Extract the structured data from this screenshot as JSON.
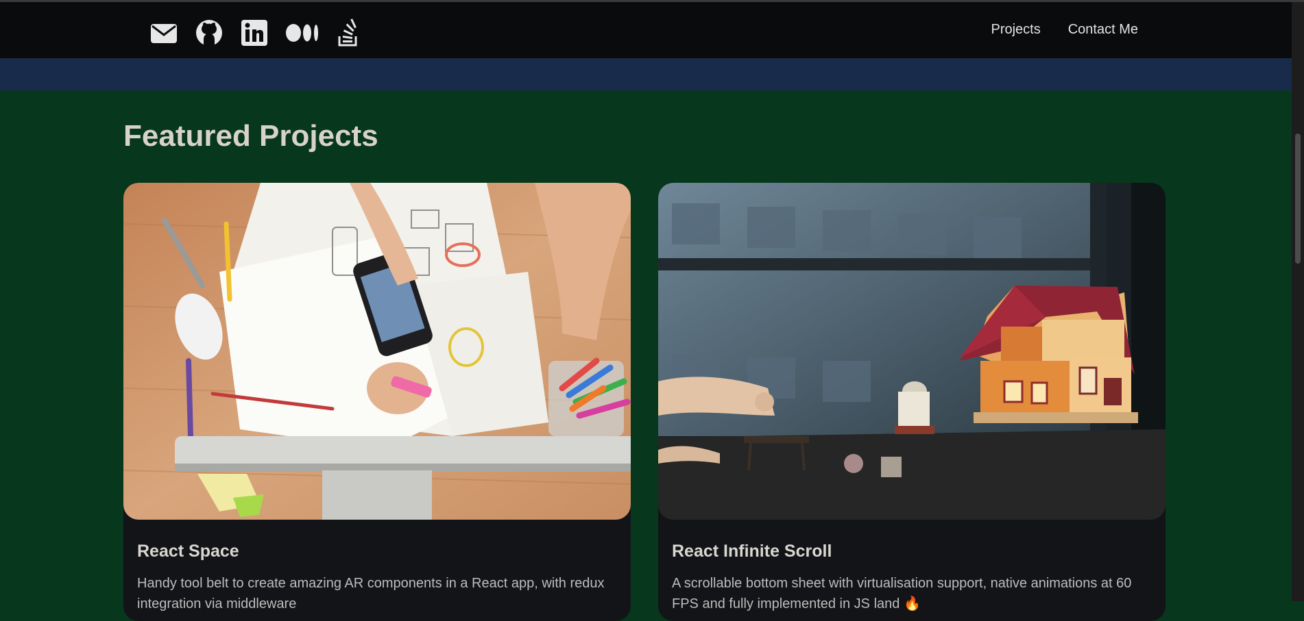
{
  "nav": {
    "social_icons": [
      "mail-icon",
      "github-icon",
      "linkedin-icon",
      "medium-icon",
      "stackoverflow-icon"
    ],
    "links": [
      "Projects",
      "Contact Me"
    ]
  },
  "main": {
    "heading": "Featured Projects",
    "projects": [
      {
        "title": "React Space",
        "description": "Handy tool belt to create amazing AR components in a React app, with redux integration via middleware",
        "image": "desk-with-phone-and-sketches"
      },
      {
        "title": "React Infinite Scroll",
        "description": "A scrollable bottom sheet with virtualisation support, native animations at 60 FPS and fully implemented in JS land 🔥",
        "image": "toy-house-by-window"
      }
    ]
  },
  "colors": {
    "navbar": "#0a0b0d",
    "band": "#192b4a",
    "section": "#07371c",
    "card": "#131417",
    "heading": "#d7d3c8"
  }
}
